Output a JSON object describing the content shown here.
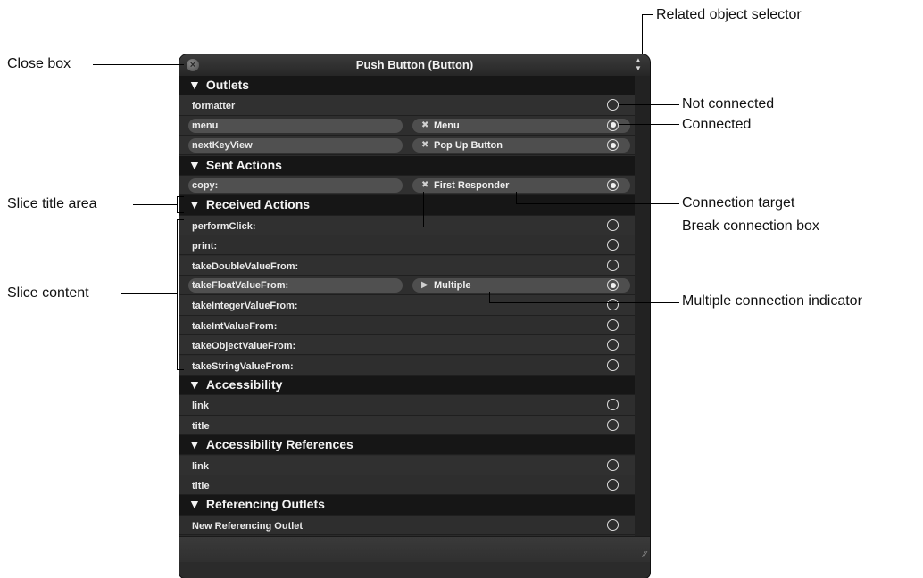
{
  "window": {
    "title": "Push Button (Button)",
    "close_icon": "close-x-icon",
    "selector_icon": "up-down-arrows-icon"
  },
  "sections": [
    {
      "title": "Outlets",
      "rows": [
        {
          "name": "formatter",
          "target": "",
          "state": "not-connected"
        },
        {
          "name": "menu",
          "target": "Menu",
          "state": "connected",
          "marker": "✖"
        },
        {
          "name": "nextKeyView",
          "target": "Pop Up Button",
          "state": "connected",
          "marker": "✖"
        }
      ]
    },
    {
      "title": "Sent Actions",
      "rows": [
        {
          "name": "copy:",
          "target": "First Responder",
          "state": "connected",
          "marker": "✖"
        }
      ]
    },
    {
      "title": "Received Actions",
      "rows": [
        {
          "name": "performClick:",
          "target": "",
          "state": "not-connected"
        },
        {
          "name": "print:",
          "target": "",
          "state": "not-connected"
        },
        {
          "name": "takeDoubleValueFrom:",
          "target": "",
          "state": "not-connected"
        },
        {
          "name": "takeFloatValueFrom:",
          "target": "Multiple",
          "state": "connected",
          "marker": "▶"
        },
        {
          "name": "takeIntegerValueFrom:",
          "target": "",
          "state": "not-connected"
        },
        {
          "name": "takeIntValueFrom:",
          "target": "",
          "state": "not-connected"
        },
        {
          "name": "takeObjectValueFrom:",
          "target": "",
          "state": "not-connected"
        },
        {
          "name": "takeStringValueFrom:",
          "target": "",
          "state": "not-connected"
        }
      ]
    },
    {
      "title": "Accessibility",
      "rows": [
        {
          "name": "link",
          "target": "",
          "state": "not-connected"
        },
        {
          "name": "title",
          "target": "",
          "state": "not-connected"
        }
      ]
    },
    {
      "title": "Accessibility References",
      "rows": [
        {
          "name": "link",
          "target": "",
          "state": "not-connected"
        },
        {
          "name": "title",
          "target": "",
          "state": "not-connected"
        }
      ]
    },
    {
      "title": "Referencing Outlets",
      "rows": [
        {
          "name": "New Referencing Outlet",
          "target": "",
          "state": "not-connected"
        }
      ]
    }
  ],
  "callouts": {
    "related_object_selector": "Related object selector",
    "close_box": "Close box",
    "not_connected": "Not connected",
    "connected": "Connected",
    "slice_title_area": "Slice title area",
    "connection_target": "Connection target",
    "break_connection_box": "Break connection box",
    "slice_content": "Slice content",
    "multiple_connection_indicator": "Multiple connection indicator"
  },
  "disclosure_icon": "▼"
}
